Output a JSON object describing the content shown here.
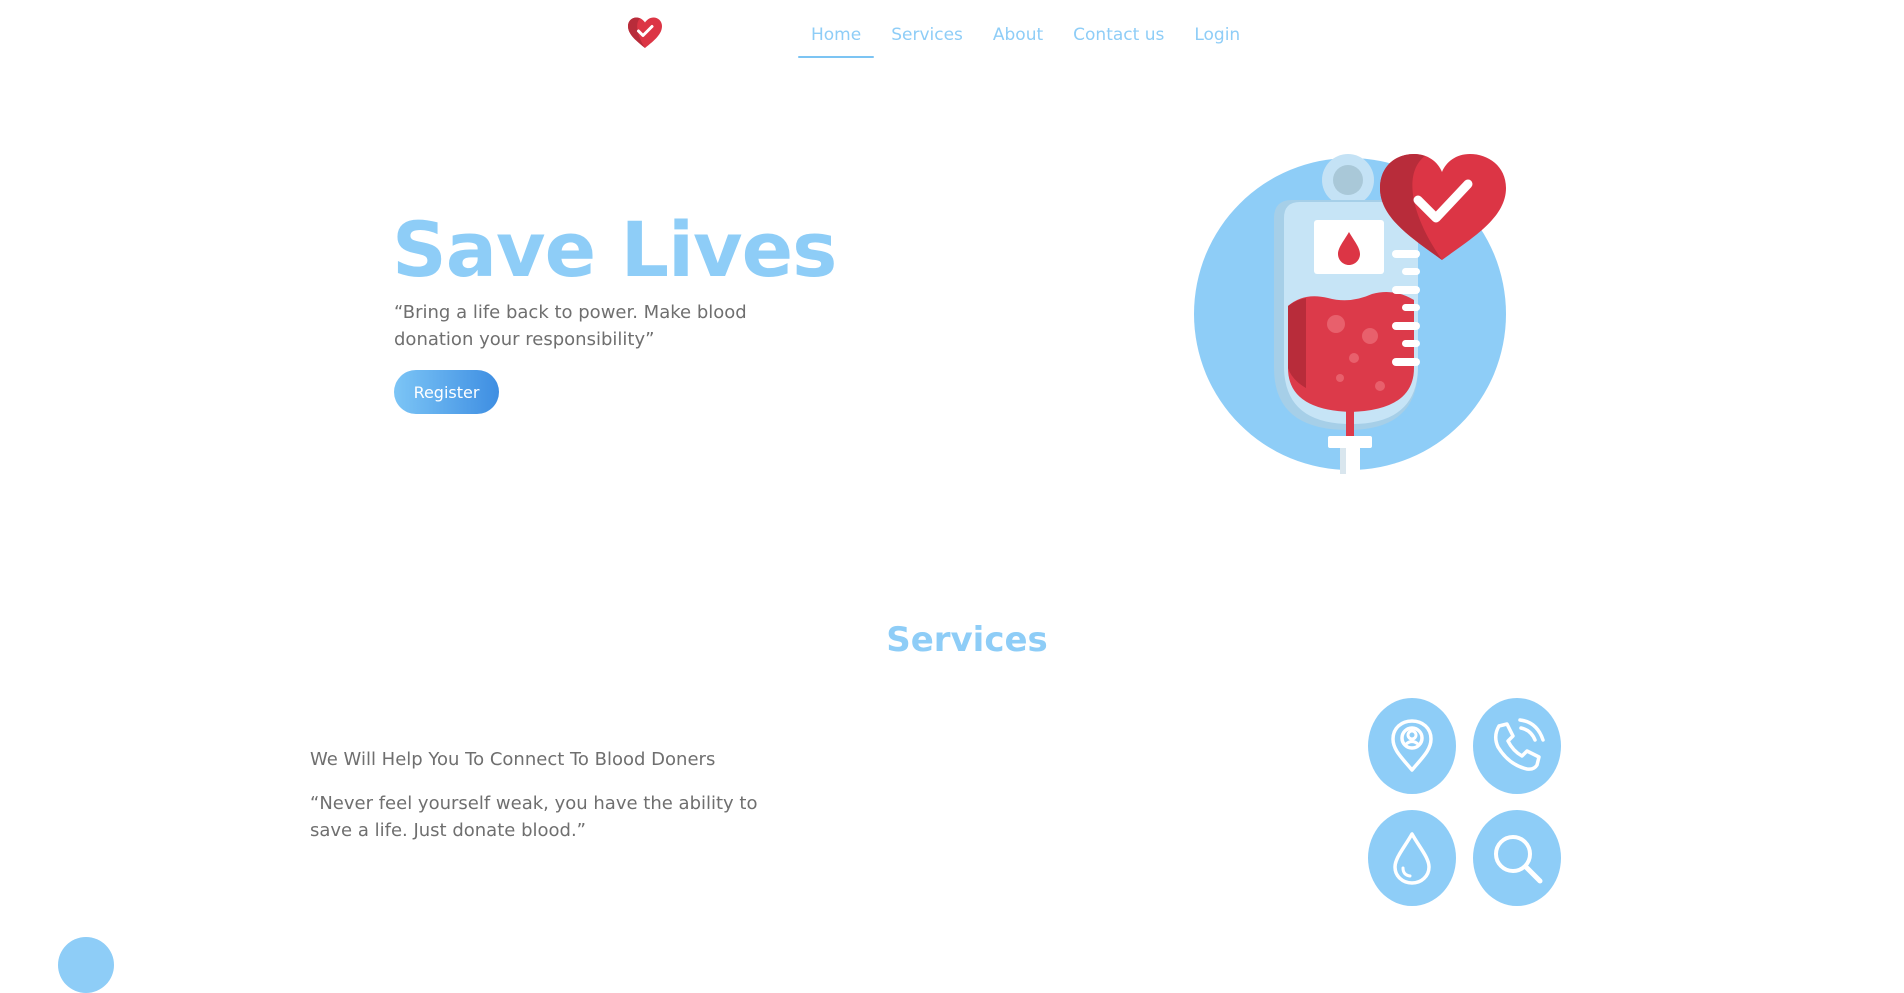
{
  "nav": {
    "logo_icon": "heart-check-icon",
    "links": [
      {
        "label": "Home",
        "active": true
      },
      {
        "label": "Services",
        "active": false
      },
      {
        "label": "About",
        "active": false
      },
      {
        "label": "Contact us",
        "active": false
      },
      {
        "label": "Login",
        "active": false
      }
    ]
  },
  "hero": {
    "title": "Save Lives",
    "quote": "“Bring a life back to power. Make blood donation your responsibility”",
    "register_label": "Register",
    "illustration": "blood-bag-heart-icon"
  },
  "services": {
    "title": "Services",
    "heading": "We Will Help You To Connect To Blood Doners",
    "quote": "“Never feel yourself weak, you have the ability to save a life. Just donate blood.”",
    "icons": [
      "location-person-icon",
      "phone-call-icon",
      "blood-drop-icon",
      "search-icon"
    ]
  },
  "colors": {
    "accent": "#8ecdf7",
    "accent_dark": "#3e8ee2",
    "heart_red": "#dc3545",
    "text_gray": "#6f6f6f"
  }
}
